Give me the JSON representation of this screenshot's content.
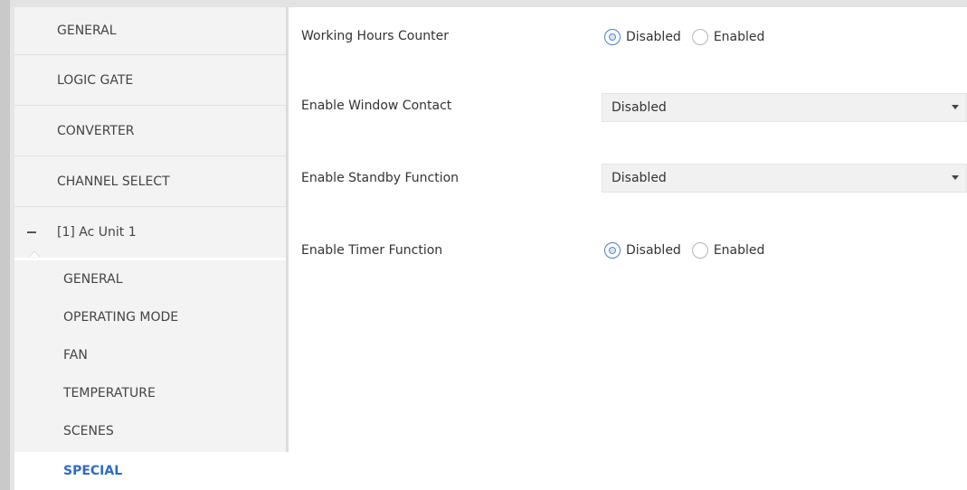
{
  "sidebar": {
    "top_items": [
      {
        "label": "GENERAL"
      },
      {
        "label": "LOGIC GATE"
      },
      {
        "label": "CONVERTER"
      },
      {
        "label": "CHANNEL SELECT"
      },
      {
        "label": "[1] Ac Unit 1"
      }
    ],
    "sub_items": [
      {
        "label": "GENERAL"
      },
      {
        "label": "OPERATING MODE"
      },
      {
        "label": "FAN"
      },
      {
        "label": "TEMPERATURE"
      },
      {
        "label": "SCENES"
      },
      {
        "label": "SPECIAL",
        "selected": true
      }
    ]
  },
  "settings": {
    "working_hours": {
      "label": "Working Hours Counter",
      "options": [
        "Disabled",
        "Enabled"
      ],
      "selected": "Disabled"
    },
    "window_contact": {
      "label": "Enable Window Contact",
      "value": "Disabled"
    },
    "standby": {
      "label": "Enable Standby Function",
      "value": "Disabled"
    },
    "timer": {
      "label": "Enable Timer Function",
      "options": [
        "Disabled",
        "Enabled"
      ],
      "selected": "Disabled"
    }
  },
  "colors": {
    "accent": "#2e6bc6",
    "sidebar_bg": "#f3f3f3",
    "select_bg": "#f1f1f1"
  },
  "icons": {
    "collapse": "minus-icon",
    "dropdown": "chevron-down-icon"
  }
}
